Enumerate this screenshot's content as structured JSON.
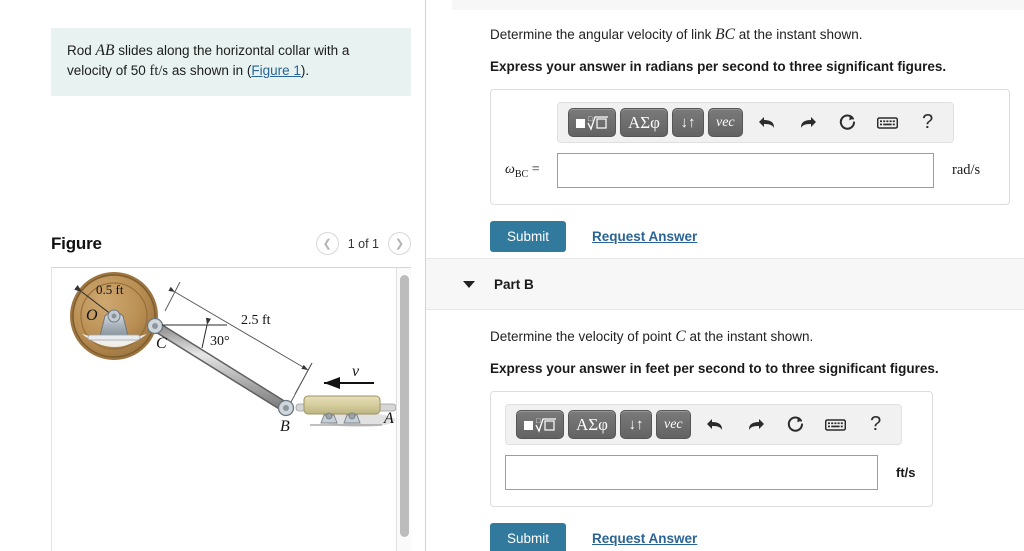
{
  "left": {
    "prompt": {
      "text_before_ab": "Rod ",
      "ab": "AB",
      "text_mid": " slides along the horizontal collar with a velocity of 50 ",
      "units": "ft/s",
      "text_after": " as shown in (",
      "link": "Figure 1",
      "text_end": ")."
    },
    "figure": {
      "title": "Figure",
      "prev_icon": "chevron-left-icon",
      "next_icon": "chevron-right-icon",
      "pager": "1 of 1",
      "diagram": {
        "radius_label": "0.5 ft",
        "link_label": "2.5 ft",
        "angle_label": "30°",
        "point_o": "O",
        "point_c": "C",
        "point_b": "B",
        "point_a": "A",
        "velocity_label": "v"
      }
    }
  },
  "right": {
    "part_a": {
      "question": "Determine the angular velocity of link ",
      "question_var": "BC",
      "question_tail": " at the instant shown.",
      "instruction": "Express your answer in radians per second to three significant figures.",
      "toolbar": {
        "template_label": "math-template",
        "greek_label": "ΑΣφ",
        "arrows_label": "↓↑",
        "vec_label": "vec",
        "undo_label": "undo-icon",
        "redo_label": "redo-icon",
        "reset_label": "reset-icon",
        "keyboard_label": "keyboard-icon",
        "help_label": "?"
      },
      "answer_label_main": "ω",
      "answer_label_sub": "BC",
      "answer_label_eq": " =",
      "answer_value": "",
      "unit": "rad/s",
      "submit": "Submit",
      "request_answer": "Request Answer"
    },
    "part_b": {
      "header": "Part B",
      "question": "Determine the velocity of point ",
      "question_var": "C",
      "question_tail": " at the instant shown.",
      "instruction": "Express your answer in feet per second to to three significant figures.",
      "toolbar": {
        "template_label": "math-template",
        "greek_label": "ΑΣφ",
        "arrows_label": "↓↑",
        "vec_label": "vec",
        "undo_label": "undo-icon",
        "redo_label": "redo-icon",
        "reset_label": "reset-icon",
        "keyboard_label": "keyboard-icon",
        "help_label": "?"
      },
      "answer_value": "",
      "unit": "ft/s",
      "submit": "Submit",
      "request_answer": "Request Answer"
    }
  },
  "colors": {
    "prompt_bg": "#e7f2f1",
    "submit_bg": "#317a9e",
    "link": "#2a6496",
    "input_border": "#7da7bf",
    "disk_body": "#b98f54",
    "disk_rim": "#a87c42"
  }
}
